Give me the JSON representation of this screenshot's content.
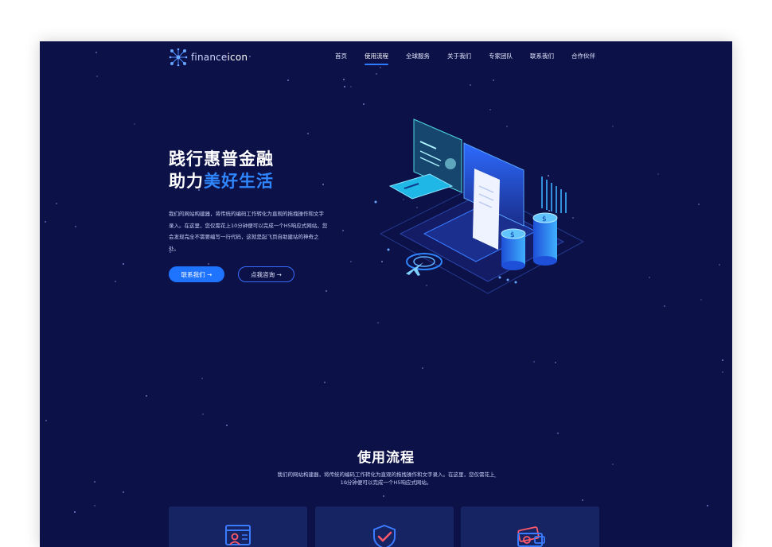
{
  "header": {
    "logo": {
      "prefix": "finance",
      "suffix": "icon"
    },
    "nav": [
      {
        "label": "首页",
        "active": false
      },
      {
        "label": "使用流程",
        "active": true
      },
      {
        "label": "全球服务",
        "active": false
      },
      {
        "label": "关于我们",
        "active": false
      },
      {
        "label": "专家团队",
        "active": false
      },
      {
        "label": "联系我们",
        "active": false
      },
      {
        "label": "合作伙伴",
        "active": false
      }
    ]
  },
  "hero": {
    "title_line1": "践行惠普金融",
    "title_line2_prefix": "助力",
    "title_line2_accent": "美好生活",
    "description": "我们的网站构建器，将传统的编码工作转化为直观的拖拽操作和文字录入。在这里，您仅需花上10分钟便可以完成一个H5响应式网站，您会发现完全不需要编写一行代码，这就是起飞页自助建站的神奇之处。",
    "primary_button": "联系我们 →",
    "secondary_button": "点我咨询 →"
  },
  "process_section": {
    "title": "使用流程",
    "description": "我们的网站构建器，将传统的编码工作转化为直观的拖拽操作和文字录入。在这里，您仅需花上10分钟便可以完成一个H5响应式网站。",
    "cards": [
      {
        "icon": "profile-document-icon"
      },
      {
        "icon": "shield-check-icon"
      },
      {
        "icon": "wallet-cash-icon"
      }
    ]
  },
  "colors": {
    "background": "#0c1148",
    "accent": "#2f86ff",
    "button_primary": "#1e73ff",
    "card": "#172463"
  }
}
